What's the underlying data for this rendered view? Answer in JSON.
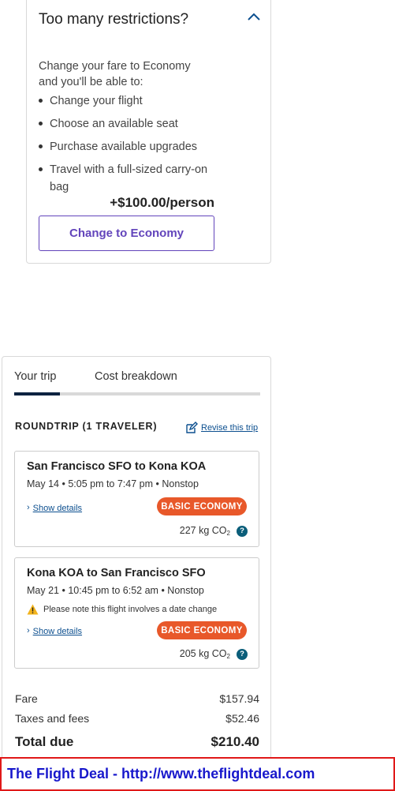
{
  "upsell": {
    "title": "Too many restrictions?",
    "subtitle": "Change your fare to Economy and you'll be able to:",
    "benefits": [
      "Change your flight",
      "Choose an available seat",
      "Purchase available upgrades",
      "Travel with a full-sized carry-on bag"
    ],
    "price": "+$100.00/person",
    "button_label": "Change to Economy",
    "accent_color": "#6244bb"
  },
  "trip": {
    "tabs": [
      "Your trip",
      "Cost breakdown"
    ],
    "active_tab": "Your trip",
    "roundtrip_label": "ROUNDTRIP (1 TRAVELER)",
    "revise_label": "Revise this trip",
    "segments": [
      {
        "route": "San Francisco SFO to Kona KOA",
        "time": "May 14 • 5:05 pm to 7:47 pm • Nonstop",
        "details_label": "Show details",
        "fare_class": "BASIC ECONOMY",
        "co2_value": "227 kg CO",
        "co2_sub": "2",
        "help_icon": "?"
      },
      {
        "route": "Kona KOA to San Francisco SFO",
        "time": "May 21 • 10:45 pm to 6:52 am • Nonstop",
        "warning": "Please note this flight involves a date change",
        "details_label": "Show details",
        "fare_class": "BASIC ECONOMY",
        "co2_value": "205 kg CO",
        "co2_sub": "2",
        "help_icon": "?"
      }
    ],
    "costs": {
      "fare_label": "Fare",
      "fare_value": "$157.94",
      "taxes_label": "Taxes and fees",
      "taxes_value": "$52.46",
      "total_label": "Total due",
      "total_value": "$210.40"
    },
    "badge_color": "#e8582a"
  },
  "banner": {
    "text": "The Flight Deal - http://www.theflightdeal.com",
    "text_color": "#1818cc",
    "border_color": "#e01818"
  },
  "icons": [
    "chevron-up-icon",
    "edit-icon",
    "chevron-right-icon",
    "warning-icon",
    "help-icon"
  ]
}
